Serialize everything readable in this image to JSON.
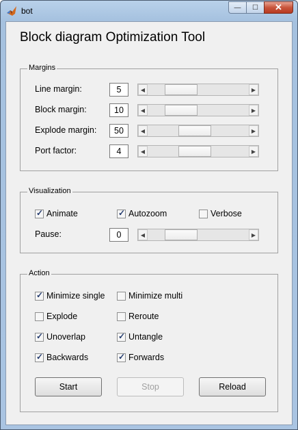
{
  "window": {
    "title": "bot",
    "min_label": "—",
    "max_label": "☐",
    "close_label": "✕"
  },
  "app_title": "Block diagram Optimization Tool",
  "margins": {
    "legend": "Margins",
    "rows": [
      {
        "label": "Line margin:",
        "value": "5",
        "slider_fraction": 0.25
      },
      {
        "label": "Block margin:",
        "value": "10",
        "slider_fraction": 0.25
      },
      {
        "label": "Explode margin:",
        "value": "50",
        "slider_fraction": 0.45
      },
      {
        "label": "Port factor:",
        "value": "4",
        "slider_fraction": 0.45
      }
    ]
  },
  "visualization": {
    "legend": "Visualization",
    "checkboxes": [
      {
        "label": "Animate",
        "checked": true
      },
      {
        "label": "Autozoom",
        "checked": true
      },
      {
        "label": "Verbose",
        "checked": false
      }
    ],
    "pause": {
      "label": "Pause:",
      "value": "0",
      "slider_fraction": 0.25
    }
  },
  "action": {
    "legend": "Action",
    "checkboxes": [
      {
        "label": "Minimize single",
        "checked": true
      },
      {
        "label": "Minimize multi",
        "checked": false
      },
      {
        "label": "Explode",
        "checked": false
      },
      {
        "label": "Reroute",
        "checked": false
      },
      {
        "label": "Unoverlap",
        "checked": true
      },
      {
        "label": "Untangle",
        "checked": true
      },
      {
        "label": "Backwards",
        "checked": true
      },
      {
        "label": "Forwards",
        "checked": true
      }
    ],
    "buttons": {
      "start": "Start",
      "stop": "Stop",
      "reload": "Reload"
    }
  },
  "colors": {
    "accent_check": "#233b6e",
    "close_button": "#c8553c"
  }
}
